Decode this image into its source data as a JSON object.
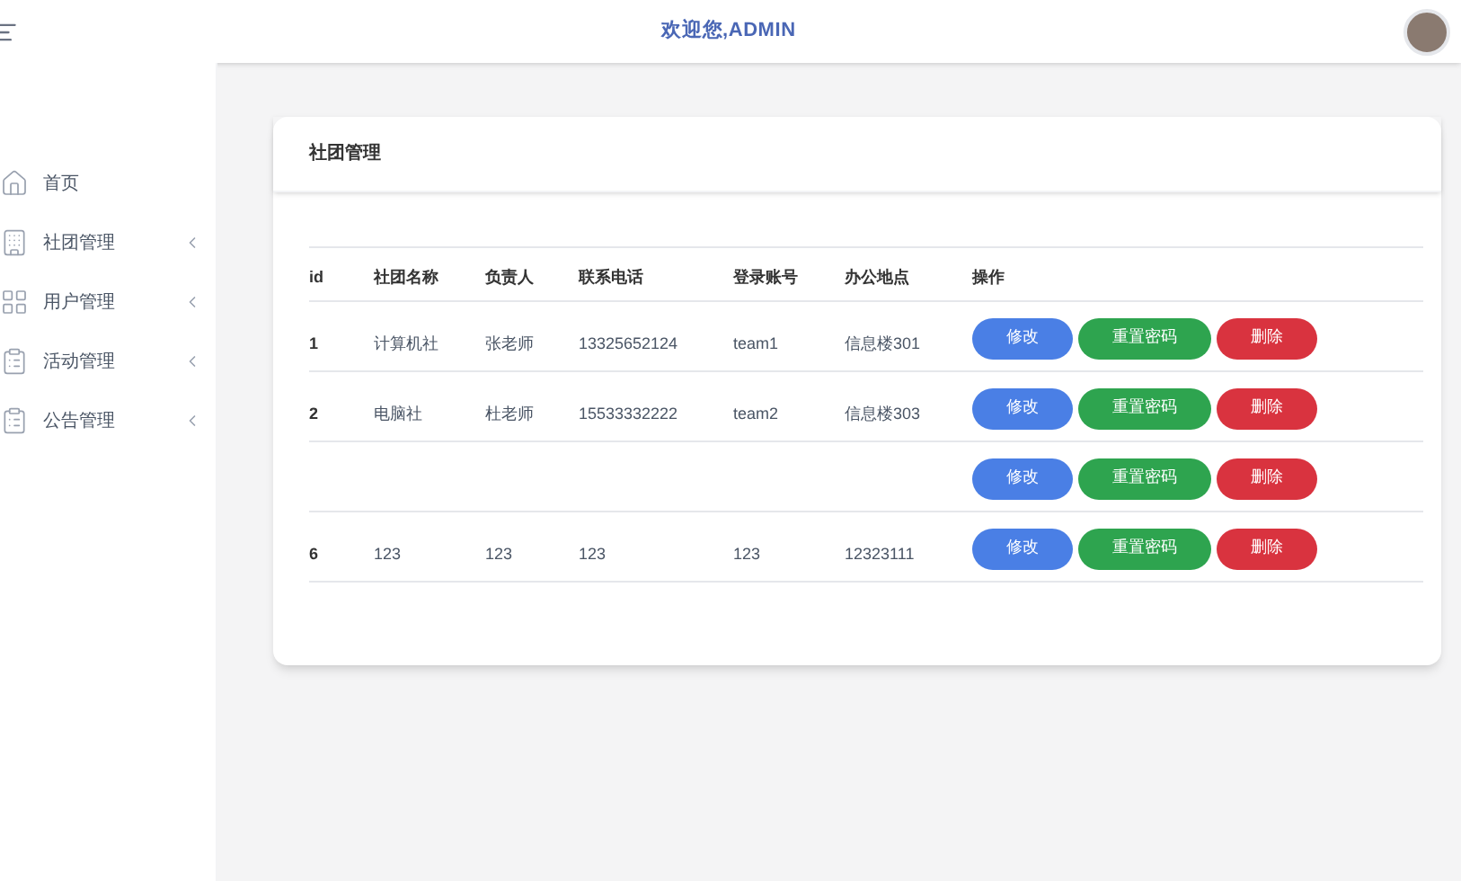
{
  "header": {
    "welcome": "欢迎您,ADMIN"
  },
  "sidebar": {
    "items": [
      {
        "label": "首页",
        "kind": "home",
        "has_submenu": false
      },
      {
        "label": "社团管理",
        "kind": "building",
        "has_submenu": true
      },
      {
        "label": "用户管理",
        "kind": "grid",
        "has_submenu": true
      },
      {
        "label": "活动管理",
        "kind": "clipboard",
        "has_submenu": true
      },
      {
        "label": "公告管理",
        "kind": "clipboard",
        "has_submenu": true
      }
    ]
  },
  "card": {
    "title": "社团管理",
    "table": {
      "columns": [
        "id",
        "社团名称",
        "负责人",
        "联系电话",
        "登录账号",
        "办公地点",
        "操作"
      ],
      "rows": [
        {
          "cells": [
            "1",
            "计算机社",
            "张老师",
            "13325652124",
            "team1",
            "信息楼301"
          ],
          "actions": [
            "修改",
            "重置密码",
            "删除"
          ]
        },
        {
          "cells": [
            "2",
            "电脑社",
            "杜老师",
            "15533332222",
            "team2",
            "信息楼303"
          ],
          "actions": [
            "修改",
            "重置密码",
            "删除"
          ]
        },
        {
          "actions": [
            "修改",
            "重置密码",
            "删除"
          ]
        },
        {
          "cells": [
            "6",
            "123",
            "123",
            "123",
            "123",
            "12323111"
          ],
          "actions": [
            "修改",
            "重置密码",
            "删除"
          ]
        }
      ]
    }
  }
}
